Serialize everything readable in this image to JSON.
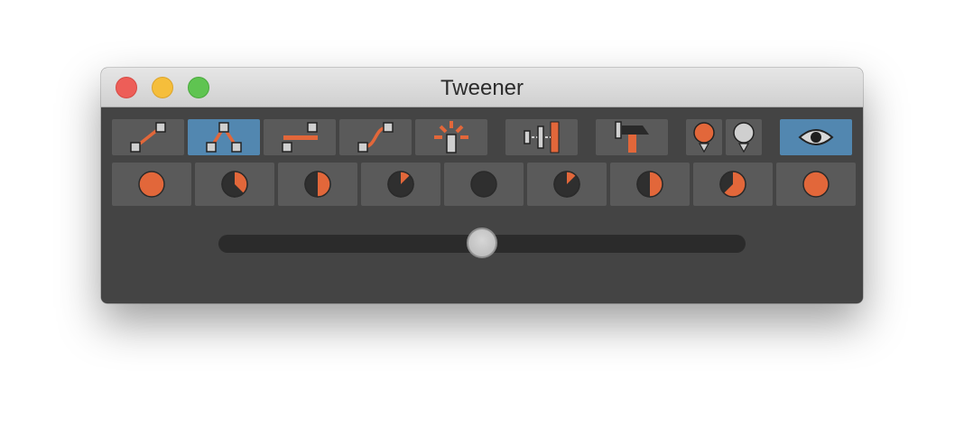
{
  "window": {
    "title": "Tweener"
  },
  "colors": {
    "accent": "#5287b0",
    "orange": "#e2673a",
    "panel": "#444444",
    "button": "#5a5a5a"
  },
  "toolbar": {
    "buttons": [
      {
        "icon": "linear-tween-icon",
        "active": false
      },
      {
        "icon": "peak-tween-icon",
        "active": true
      },
      {
        "icon": "step-tween-icon",
        "active": false
      },
      {
        "icon": "ease-curve-icon",
        "active": false
      },
      {
        "icon": "sparkle-key-icon",
        "active": false
      },
      {
        "icon": "align-keys-icon",
        "active": false
      },
      {
        "icon": "hammer-icon",
        "active": false
      },
      {
        "icon": "orange-pin-icon",
        "active": false
      },
      {
        "icon": "gray-pin-icon",
        "active": false
      },
      {
        "icon": "eye-icon",
        "active": true
      }
    ]
  },
  "phases": [
    1,
    0.375,
    0.5,
    0.125,
    0,
    0.125,
    0.5,
    0.625,
    1
  ],
  "slider": {
    "value": 0.5
  }
}
